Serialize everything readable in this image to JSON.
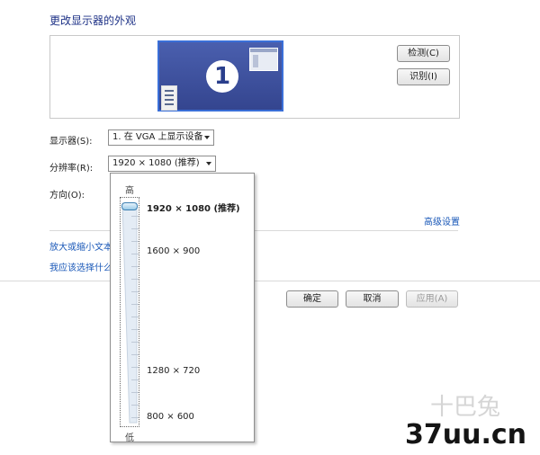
{
  "window": {
    "title": "更改显示器的外观"
  },
  "preview": {
    "monitor_number": "1",
    "detect_label": "检测(C)",
    "identify_label": "识别(I)"
  },
  "settings": {
    "display_label": "显示器(S):",
    "display_value": "1. 在 VGA 上显示设备",
    "resolution_label": "分辨率(R):",
    "resolution_value": "1920 × 1080 (推荐)",
    "orientation_label": "方向(O):"
  },
  "links": {
    "advanced": "高级设置",
    "enlarge_text": "放大或缩小文本",
    "which_settings": "我应该选择什么"
  },
  "footer": {
    "ok_label": "确定",
    "cancel_label": "取消",
    "apply_label": "应用(A)"
  },
  "resolution_dropdown": {
    "high_label": "高",
    "low_label": "低",
    "selected_index": 0,
    "slider_level": 1.0,
    "options": [
      {
        "label": "1920 × 1080 (推荐)",
        "bold": true
      },
      {
        "label": "1600 × 900",
        "bold": false
      },
      {
        "label": "1280 × 720",
        "bold": false
      },
      {
        "label": "800 × 600",
        "bold": false
      }
    ]
  },
  "watermark": {
    "site": "37uu.cn",
    "faint_text": "十巴兔"
  },
  "colors": {
    "title": "#1e3287",
    "link": "#1a58b8",
    "monitor_bg": "#3d51a0",
    "monitor_border": "#3a6fd8"
  }
}
